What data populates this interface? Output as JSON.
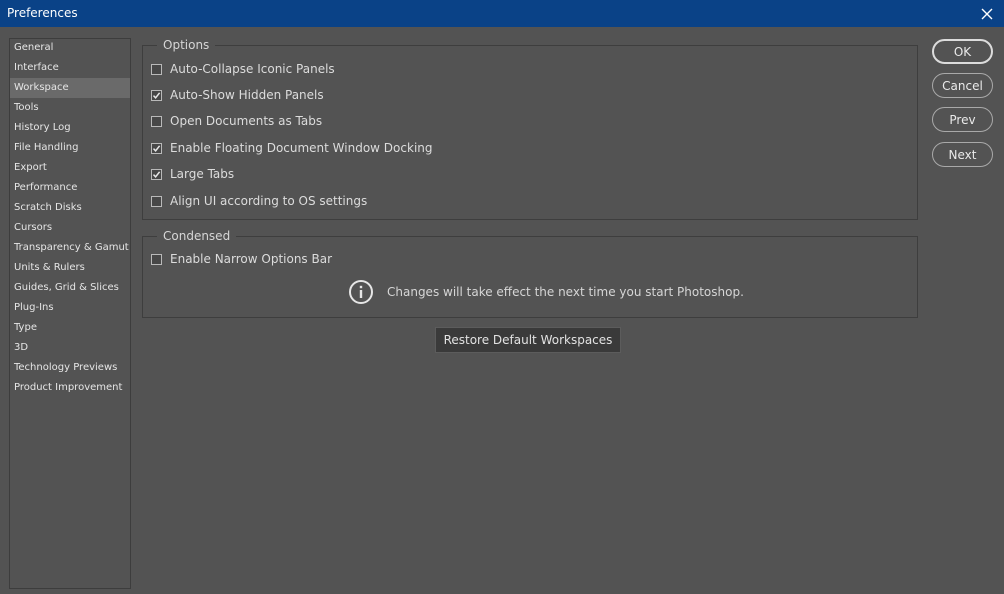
{
  "window": {
    "title": "Preferences"
  },
  "sidebar": {
    "items": [
      {
        "label": "General",
        "selected": false
      },
      {
        "label": "Interface",
        "selected": false
      },
      {
        "label": "Workspace",
        "selected": true
      },
      {
        "label": "Tools",
        "selected": false
      },
      {
        "label": "History Log",
        "selected": false
      },
      {
        "label": "File Handling",
        "selected": false
      },
      {
        "label": "Export",
        "selected": false
      },
      {
        "label": "Performance",
        "selected": false
      },
      {
        "label": "Scratch Disks",
        "selected": false
      },
      {
        "label": "Cursors",
        "selected": false
      },
      {
        "label": "Transparency & Gamut",
        "selected": false
      },
      {
        "label": "Units & Rulers",
        "selected": false
      },
      {
        "label": "Guides, Grid & Slices",
        "selected": false
      },
      {
        "label": "Plug-Ins",
        "selected": false
      },
      {
        "label": "Type",
        "selected": false
      },
      {
        "label": "3D",
        "selected": false
      },
      {
        "label": "Technology Previews",
        "selected": false
      },
      {
        "label": "Product Improvement",
        "selected": false
      }
    ]
  },
  "options": {
    "legend": "Options",
    "items": [
      {
        "label": "Auto-Collapse Iconic Panels",
        "checked": false
      },
      {
        "label": "Auto-Show Hidden Panels",
        "checked": true
      },
      {
        "label": "Open Documents as Tabs",
        "checked": false
      },
      {
        "label": "Enable Floating Document Window Docking",
        "checked": true
      },
      {
        "label": "Large Tabs",
        "checked": true
      },
      {
        "label": "Align UI according to OS settings",
        "checked": false
      }
    ]
  },
  "condensed": {
    "legend": "Condensed",
    "narrow_bar": {
      "label": "Enable Narrow Options Bar",
      "checked": false
    },
    "info_text": "Changes will take effect the next time you start Photoshop."
  },
  "restore_button": "Restore Default Workspaces",
  "buttons": {
    "ok": "OK",
    "cancel": "Cancel",
    "prev": "Prev",
    "next": "Next"
  },
  "icons": {
    "close": "close-icon",
    "check": "checkmark-icon",
    "info": "info-icon"
  },
  "colors": {
    "titlebar": "#0a4287",
    "background": "#535353",
    "selected": "#6a6a6a"
  }
}
